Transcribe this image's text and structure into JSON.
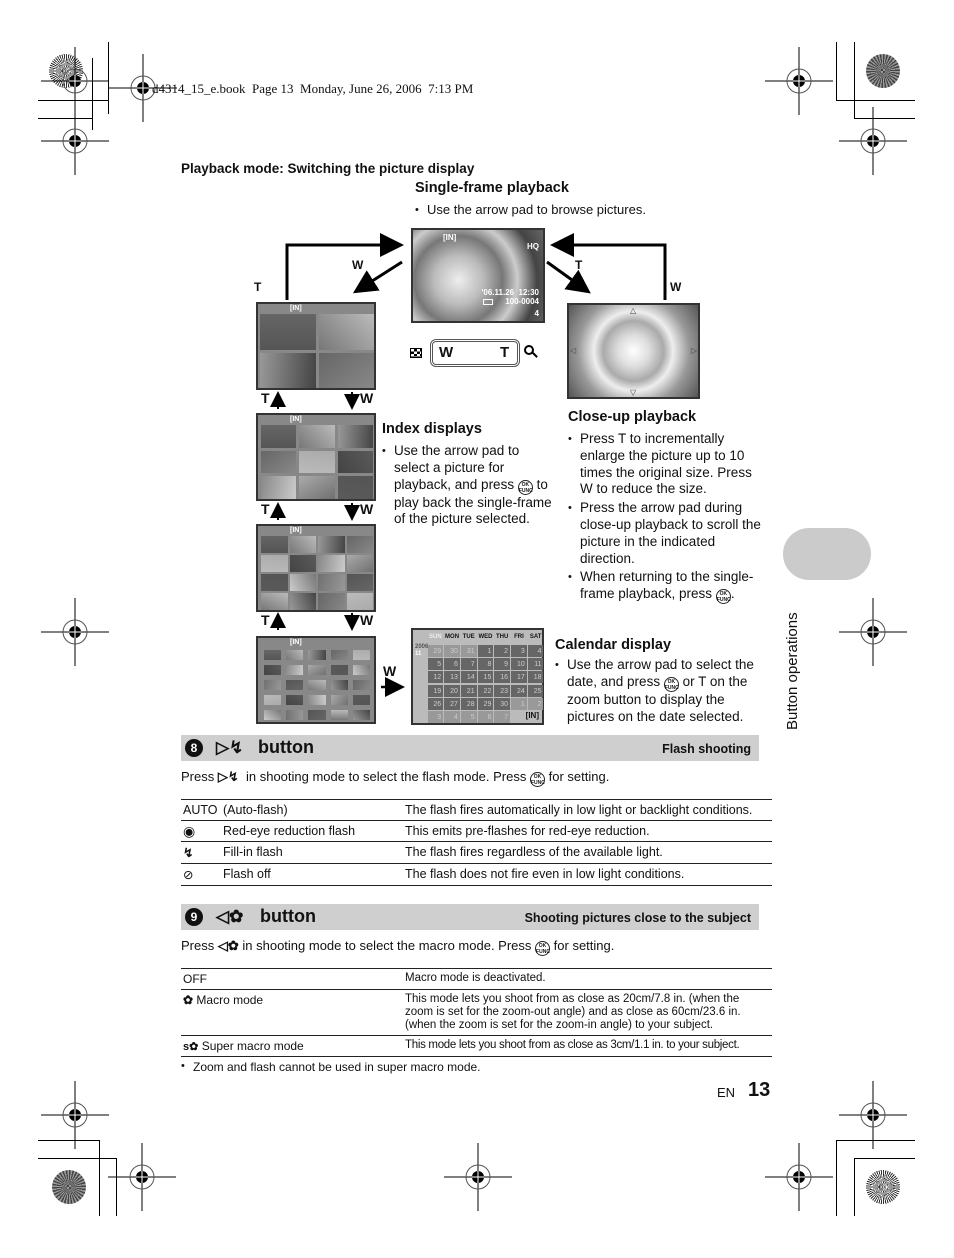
{
  "book_header": "d4314_15_e.book  Page 13  Monday, June 26, 2006  7:13 PM",
  "page_heading": "Playback mode: Switching the picture display",
  "single_frame": {
    "title": "Single-frame playback",
    "bullets": [
      "Use the arrow pad to browse pictures."
    ],
    "screen": {
      "top_label": "[IN]",
      "quality": "HQ",
      "datetime": "'06.11.26  12:30",
      "file_number": "100-0004",
      "frame": "4"
    }
  },
  "zoom_lever": {
    "wide_icon": "index-grid-icon",
    "w_label": "W",
    "t_label": "T",
    "tele_icon": "magnifier-icon"
  },
  "arrows": {
    "to_index_label": "W",
    "from_index_label": "T",
    "to_closeup_label": "T",
    "from_closeup_label": "W",
    "index_steps": [
      {
        "up": "T",
        "down": "W"
      },
      {
        "up": "T",
        "down": "W"
      },
      {
        "up": "T",
        "down": "W"
      }
    ],
    "to_calendar_label": "W"
  },
  "index_displays": {
    "title": "Index displays",
    "screen_label": "[IN]",
    "layouts": [
      "4 frames",
      "9 frames",
      "16 frames",
      "25 frames"
    ],
    "bullet_parts": {
      "before_ok": "Use the arrow pad to select a picture for playback, and press",
      "after_ok": "to play back the single-frame of the picture selected."
    }
  },
  "close_up": {
    "title": "Close-up playback",
    "bullets": [
      "Press T to incrementally enlarge the picture up to 10 times the original size. Press W to reduce the size.",
      "Press the arrow pad during close-up playback to scroll the picture in the indicated direction."
    ],
    "last_bullet_parts": {
      "before_ok": "When returning to the single-frame playback, press",
      "after_ok": "."
    }
  },
  "calendar": {
    "title": "Calendar display",
    "year": "2006",
    "month": "11",
    "days_header": [
      "SUN",
      "MON",
      "TUE",
      "WED",
      "THU",
      "FRI",
      "SAT"
    ],
    "weeks": [
      [
        "29",
        "30",
        "31",
        "1",
        "2",
        "3",
        "4"
      ],
      [
        "5",
        "6",
        "7",
        "8",
        "9",
        "10",
        "11"
      ],
      [
        "12",
        "13",
        "14",
        "15",
        "16",
        "17",
        "18"
      ],
      [
        "19",
        "20",
        "21",
        "22",
        "23",
        "24",
        "25"
      ],
      [
        "26",
        "27",
        "28",
        "29",
        "30",
        "1",
        "2"
      ],
      [
        "3",
        "4",
        "5",
        "6",
        "7",
        "",
        ""
      ]
    ],
    "footer_label": "[IN]",
    "bullet_parts": {
      "before_ok": "Use the arrow pad to select the date, and press",
      "after_ok": "or T on the zoom button to display the pictures on the date selected."
    }
  },
  "ok_button": {
    "top": "OK",
    "bottom": "FUNC"
  },
  "side_tab": "Button operations",
  "flash_section": {
    "number": "8",
    "icon": "right-arrow-flash-icon",
    "title": "button",
    "subtitle": "Flash shooting",
    "intro_before": "Press",
    "intro_middle": "in shooting mode to select the flash mode. Press",
    "intro_after": "for setting.",
    "rows": [
      {
        "icon": "AUTO",
        "mode": "(Auto-flash)",
        "desc": "The flash fires automatically in low light or backlight conditions."
      },
      {
        "icon": "red-eye-icon",
        "mode": "Red-eye reduction flash",
        "desc": "This emits pre-flashes for red-eye reduction."
      },
      {
        "icon": "flash-icon",
        "mode": "Fill-in flash",
        "desc": "The flash fires regardless of the available light."
      },
      {
        "icon": "flash-off-icon",
        "mode": "Flash off",
        "desc": "The flash does not fire even in low light conditions."
      }
    ]
  },
  "macro_section": {
    "number": "9",
    "icon": "left-arrow-macro-icon",
    "title": "button",
    "subtitle": "Shooting pictures close to the subject",
    "intro_before": "Press",
    "intro_middle": "in shooting mode to select the macro mode. Press",
    "intro_after": "for setting.",
    "rows": [
      {
        "icon": "",
        "mode": "OFF",
        "desc": "Macro mode is deactivated."
      },
      {
        "icon": "macro-icon",
        "mode": "Macro mode",
        "desc": "This mode lets you shoot from as close as 20cm/7.8 in. (when the zoom is set for the zoom-out angle) and as close as 60cm/23.6 in. (when the zoom is set for the zoom-in angle) to your subject."
      },
      {
        "icon": "super-macro-icon",
        "mode": "Super macro mode",
        "desc": "This mode lets you shoot from as close as 3cm/1.1 in. to your subject."
      }
    ],
    "note": "Zoom and flash cannot be used in super macro mode."
  },
  "footer": {
    "lang": "EN",
    "page_number": "13"
  }
}
